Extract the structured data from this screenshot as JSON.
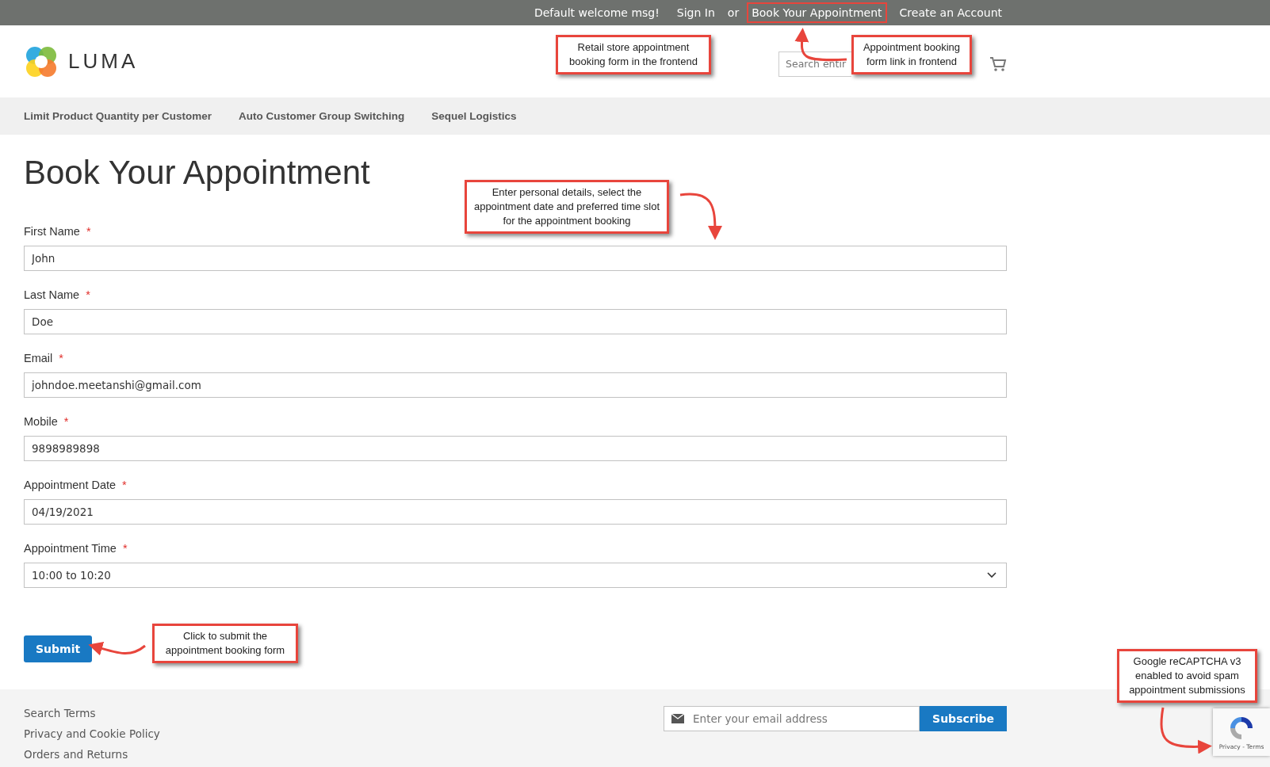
{
  "top_bar": {
    "welcome": "Default welcome msg!",
    "sign_in": "Sign In",
    "separator": "or",
    "links": [
      {
        "label": "Book Your Appointment",
        "highlighted": true
      },
      {
        "label": "Create an Account",
        "highlighted": false
      }
    ]
  },
  "header": {
    "logo_text": "LUMA",
    "search": {
      "placeholder": "Search entir"
    }
  },
  "nav": [
    "Limit Product Quantity per Customer",
    "Auto Customer Group Switching",
    "Sequel Logistics"
  ],
  "page_title": "Book Your Appointment",
  "fields": [
    {
      "label": "First Name",
      "required": true,
      "required_mark": "*",
      "kind": "text",
      "value": "John"
    },
    {
      "label": "Last Name",
      "required": true,
      "required_mark": "*",
      "kind": "text",
      "value": "Doe"
    },
    {
      "label": "Email",
      "required": true,
      "required_mark": "*",
      "kind": "text",
      "value": "johndoe.meetanshi@gmail.com"
    },
    {
      "label": "Mobile",
      "required": true,
      "required_mark": "*",
      "kind": "text",
      "value": "9898989898"
    },
    {
      "label": "Appointment Date",
      "required": true,
      "required_mark": "*",
      "kind": "text",
      "value": "04/19/2021"
    },
    {
      "label": "Appointment Time",
      "required": true,
      "required_mark": "*",
      "kind": "select",
      "value": "10:00 to 10:20"
    }
  ],
  "submit": "Submit",
  "footer": {
    "links": [
      "Search Terms",
      "Privacy and Cookie Policy",
      "Orders and Returns"
    ],
    "newsletter": {
      "placeholder": "Enter your email address",
      "button": "Subscribe"
    },
    "recaptcha": {
      "links": "Privacy - Terms"
    }
  },
  "annotations": [
    {
      "text": "Retail store appointment booking form in the frontend",
      "kind": "plain"
    },
    {
      "text": "Appointment booking form link in frontend",
      "kind": "link"
    },
    {
      "text": "Enter personal details, select the appointment date and preferred time slot for the appointment booking",
      "kind": "fields"
    },
    {
      "text": "Click to submit the appointment booking form",
      "kind": "submit"
    },
    {
      "text": "Google reCAPTCHA v3 enabled to avoid spam appointment submissions",
      "kind": "captcha"
    }
  ]
}
